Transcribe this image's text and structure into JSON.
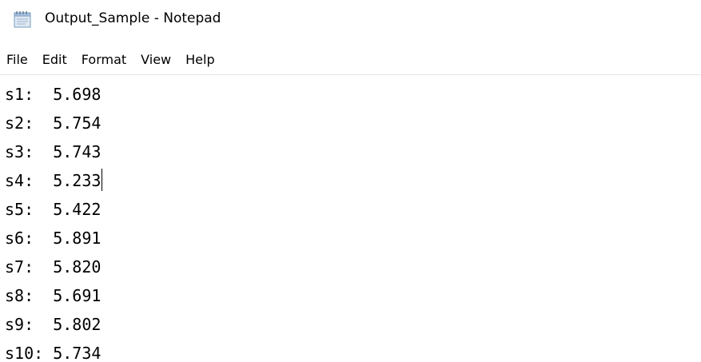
{
  "window": {
    "title": "Output_Sample - Notepad",
    "icon": "notepad-icon"
  },
  "menu": {
    "items": [
      "File",
      "Edit",
      "Format",
      "View",
      "Help"
    ]
  },
  "editor": {
    "lines": [
      "s1:  5.698",
      "s2:  5.754",
      "s3:  5.743",
      "s4:  5.233",
      "s5:  5.422",
      "s6:  5.891",
      "s7:  5.820",
      "s8:  5.691",
      "s9:  5.802",
      "s10: 5.734"
    ],
    "caret_line": 4
  }
}
